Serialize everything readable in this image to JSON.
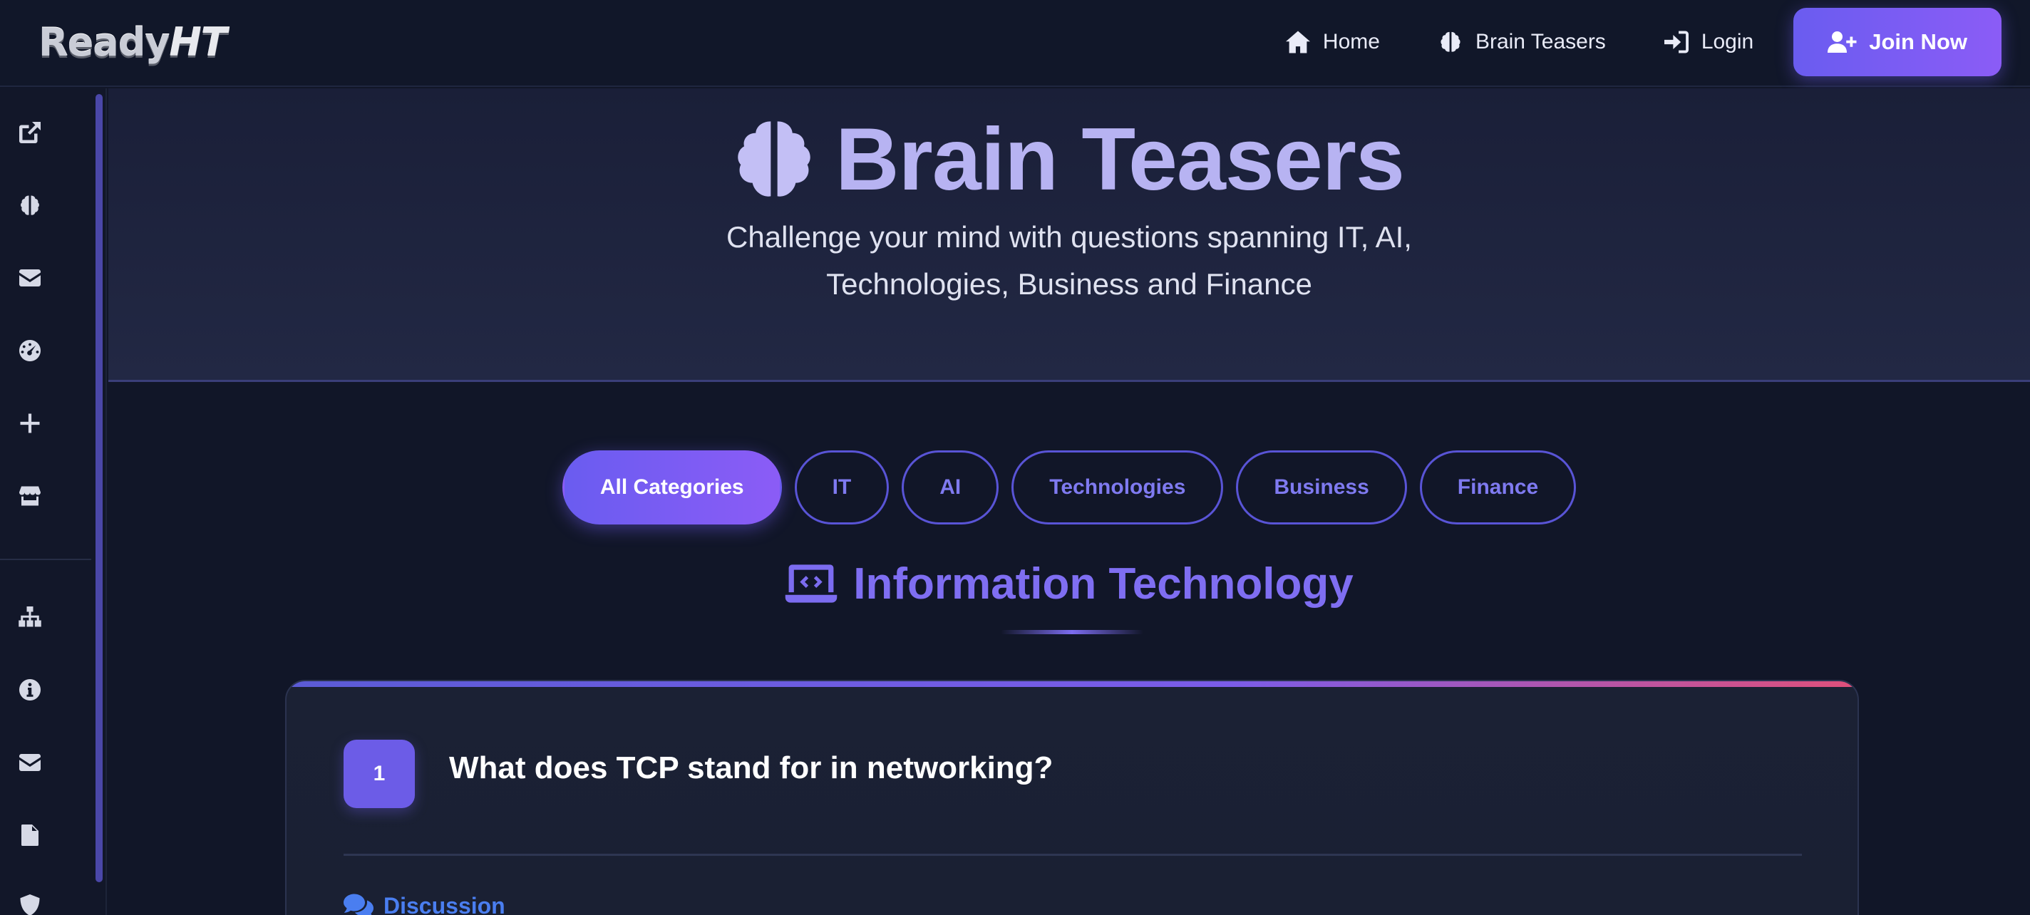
{
  "header": {
    "logo_text": "Ready",
    "logo_accent": "HT",
    "nav": [
      {
        "label": "Home",
        "icon": "home-icon"
      },
      {
        "label": "Brain Teasers",
        "icon": "brain-icon"
      },
      {
        "label": "Login",
        "icon": "login-icon"
      }
    ],
    "join_label": "Join Now"
  },
  "sidebar": {
    "icons": [
      "external-link-icon",
      "brain-icon",
      "envelope-icon",
      "gauge-icon",
      "plus-icon",
      "store-icon",
      "sitemap-icon",
      "info-icon",
      "envelope-icon",
      "file-icon",
      "shield-icon"
    ]
  },
  "hero": {
    "title": "Brain Teasers",
    "subtitle_line1": "Challenge your mind with questions spanning IT, AI,",
    "subtitle_line2": "Technologies, Business and Finance"
  },
  "categories": {
    "items": [
      "All Categories",
      "IT",
      "AI",
      "Technologies",
      "Business",
      "Finance"
    ],
    "active": "All Categories"
  },
  "section": {
    "title": "Information Technology",
    "icon": "laptop-code-icon"
  },
  "question": {
    "number": "1",
    "text": "What does TCP stand for in networking?",
    "discussion_label": "Discussion"
  },
  "colors": {
    "background": "#111628",
    "accent": "#6c5ce7",
    "hero_title": "#b7b3f2",
    "section_title": "#7f6ef2",
    "discussion": "#4a7ef0"
  }
}
